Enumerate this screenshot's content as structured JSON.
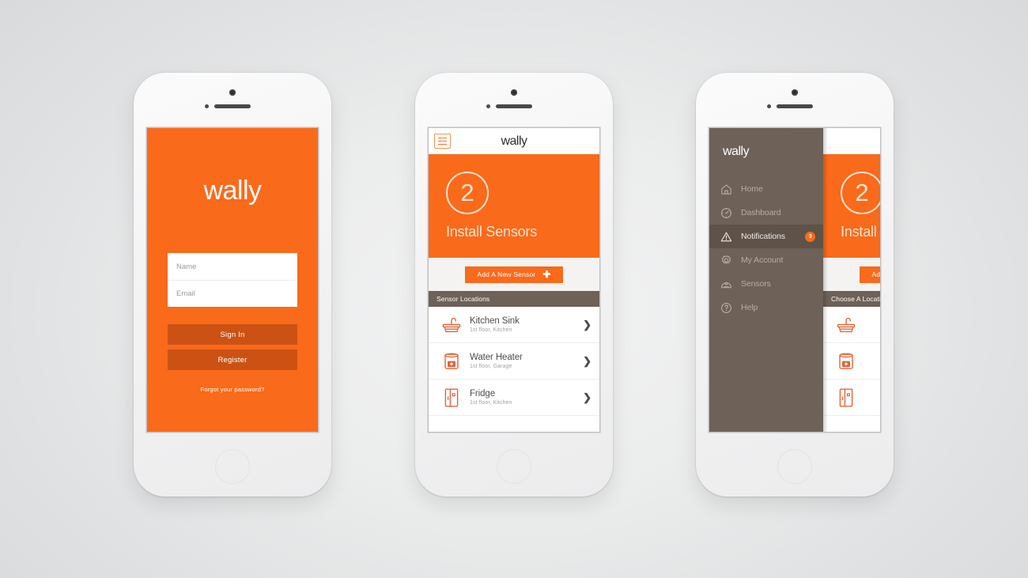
{
  "brand": {
    "wordmark": "wally",
    "orange": "#f96a1b",
    "orange_dark": "#cc5214",
    "brown": "#6e6158",
    "cream": "#fbe3cf"
  },
  "screen_login": {
    "logo": "wally",
    "fields": [
      {
        "name": "name-field",
        "placeholder": "Name",
        "value": ""
      },
      {
        "name": "email-field",
        "placeholder": "Email",
        "value": ""
      }
    ],
    "sign_in_label": "Sign In",
    "register_label": "Register",
    "forgot_label": "Forgot your password?"
  },
  "screen_install": {
    "appbar": {
      "logo": "wally",
      "menu_icon": "hamburger-icon"
    },
    "hero": {
      "step_number": "2",
      "title": "Install Sensors"
    },
    "add_button": {
      "label": "Add A New Sensor",
      "icon": "plus-icon"
    },
    "list_header": "Sensor Locations",
    "sensors": [
      {
        "icon": "sink-icon",
        "name": "Kitchen Sink",
        "location": "1st floor, Kitchen",
        "chevron": "❯"
      },
      {
        "icon": "heater-icon",
        "name": "Water Heater",
        "location": "1st floor, Garage",
        "chevron": "❯"
      },
      {
        "icon": "fridge-icon",
        "name": "Fridge",
        "location": "1st floor, Kitchen",
        "chevron": "❯"
      }
    ]
  },
  "screen_drawer": {
    "logo": "wally",
    "nav_items": [
      {
        "icon": "home-icon",
        "label": "Home",
        "active": false,
        "badge": ""
      },
      {
        "icon": "gauge-icon",
        "label": "Dashboard",
        "active": false,
        "badge": ""
      },
      {
        "icon": "warning-icon",
        "label": "Notifications",
        "active": true,
        "badge": "3"
      },
      {
        "icon": "gear-icon",
        "label": "My Account",
        "active": false,
        "badge": ""
      },
      {
        "icon": "sensor-icon",
        "label": "Sensors",
        "active": false,
        "badge": ""
      },
      {
        "icon": "question-mark-icon",
        "label": "Help",
        "active": false,
        "badge": ""
      }
    ],
    "peek": {
      "menu_icon": "hamburger-icon",
      "step_number": "2",
      "title": "Install Sensors",
      "add_button_label": "Add A New Sensor",
      "list_header": "Choose A Location",
      "sensors": [
        {
          "icon": "sink-icon"
        },
        {
          "icon": "heater-icon"
        },
        {
          "icon": "fridge-icon"
        }
      ]
    }
  }
}
